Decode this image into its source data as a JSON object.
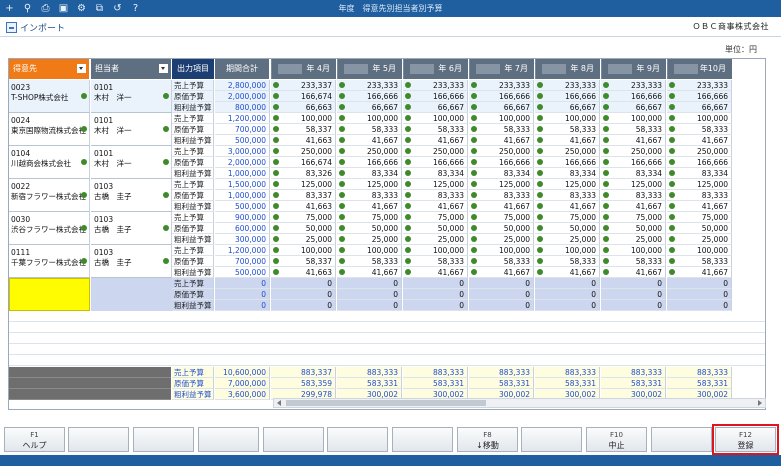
{
  "window": {
    "title": "年度　得意先別担当者別予算",
    "toolbar_icons": [
      "add-icon",
      "zoom-icon",
      "print-icon",
      "view-icon",
      "settings-icon",
      "copy-icon",
      "history-icon",
      "help-icon"
    ]
  },
  "toolbar": {
    "import_label": "インポート",
    "company": "ＯＢＣ商事株式会社"
  },
  "unit_label": "単位：円",
  "grid": {
    "headers": {
      "customer": "得意先",
      "person": "担当者",
      "item": "出力項目",
      "total": "期間合計",
      "months": [
        "年 4月",
        "年 5月",
        "年 6月",
        "年 7月",
        "年 8月",
        "年 9月",
        "年10月"
      ]
    },
    "item_labels": [
      "売上予算",
      "原価予算",
      "粗利益予算"
    ],
    "groups": [
      {
        "cust_code": "0023",
        "cust_name": "T-SHOP株式会社",
        "person_code": "0101",
        "person_name": "木村　洋一",
        "rows": [
          {
            "total": "2,800,000",
            "months": [
              "233,337",
              "233,333",
              "233,333",
              "233,333",
              "233,333",
              "233,333",
              "233,333"
            ]
          },
          {
            "total": "2,000,000",
            "months": [
              "166,674",
              "166,666",
              "166,666",
              "166,666",
              "166,666",
              "166,666",
              "166,666"
            ]
          },
          {
            "total": "800,000",
            "months": [
              "66,663",
              "66,667",
              "66,667",
              "66,667",
              "66,667",
              "66,667",
              "66,667"
            ]
          }
        ]
      },
      {
        "cust_code": "0024",
        "cust_name": "東京国際物流株式会社",
        "person_code": "0101",
        "person_name": "木村　洋一",
        "rows": [
          {
            "total": "1,200,000",
            "months": [
              "100,000",
              "100,000",
              "100,000",
              "100,000",
              "100,000",
              "100,000",
              "100,000"
            ]
          },
          {
            "total": "700,000",
            "months": [
              "58,337",
              "58,333",
              "58,333",
              "58,333",
              "58,333",
              "58,333",
              "58,333"
            ]
          },
          {
            "total": "500,000",
            "months": [
              "41,663",
              "41,667",
              "41,667",
              "41,667",
              "41,667",
              "41,667",
              "41,667"
            ]
          }
        ]
      },
      {
        "cust_code": "0104",
        "cust_name": "川越商会株式会社",
        "person_code": "0101",
        "person_name": "木村　洋一",
        "rows": [
          {
            "total": "3,000,000",
            "months": [
              "250,000",
              "250,000",
              "250,000",
              "250,000",
              "250,000",
              "250,000",
              "250,000"
            ]
          },
          {
            "total": "2,000,000",
            "months": [
              "166,674",
              "166,666",
              "166,666",
              "166,666",
              "166,666",
              "166,666",
              "166,666"
            ]
          },
          {
            "total": "1,000,000",
            "months": [
              "83,326",
              "83,334",
              "83,334",
              "83,334",
              "83,334",
              "83,334",
              "83,334"
            ]
          }
        ]
      },
      {
        "cust_code": "0022",
        "cust_name": "新宿フラワー株式会社",
        "person_code": "0103",
        "person_name": "古橋　圭子",
        "rows": [
          {
            "total": "1,500,000",
            "months": [
              "125,000",
              "125,000",
              "125,000",
              "125,000",
              "125,000",
              "125,000",
              "125,000"
            ]
          },
          {
            "total": "1,000,000",
            "months": [
              "83,337",
              "83,333",
              "83,333",
              "83,333",
              "83,333",
              "83,333",
              "83,333"
            ]
          },
          {
            "total": "500,000",
            "months": [
              "41,663",
              "41,667",
              "41,667",
              "41,667",
              "41,667",
              "41,667",
              "41,667"
            ]
          }
        ]
      },
      {
        "cust_code": "0030",
        "cust_name": "渋谷フラワー株式会社",
        "person_code": "0103",
        "person_name": "古橋　圭子",
        "rows": [
          {
            "total": "900,000",
            "months": [
              "75,000",
              "75,000",
              "75,000",
              "75,000",
              "75,000",
              "75,000",
              "75,000"
            ]
          },
          {
            "total": "600,000",
            "months": [
              "50,000",
              "50,000",
              "50,000",
              "50,000",
              "50,000",
              "50,000",
              "50,000"
            ]
          },
          {
            "total": "300,000",
            "months": [
              "25,000",
              "25,000",
              "25,000",
              "25,000",
              "25,000",
              "25,000",
              "25,000"
            ]
          }
        ]
      },
      {
        "cust_code": "0111",
        "cust_name": "千葉フラワー株式会社",
        "person_code": "0103",
        "person_name": "古橋　圭子",
        "rows": [
          {
            "total": "1,200,000",
            "months": [
              "100,000",
              "100,000",
              "100,000",
              "100,000",
              "100,000",
              "100,000",
              "100,000"
            ]
          },
          {
            "total": "700,000",
            "months": [
              "58,337",
              "58,333",
              "58,333",
              "58,333",
              "58,333",
              "58,333",
              "58,333"
            ]
          },
          {
            "total": "500,000",
            "months": [
              "41,663",
              "41,667",
              "41,667",
              "41,667",
              "41,667",
              "41,667",
              "41,667"
            ]
          }
        ]
      }
    ],
    "empty_rows": [
      {
        "total": "0",
        "months": [
          "0",
          "0",
          "0",
          "0",
          "0",
          "0",
          "0"
        ]
      },
      {
        "total": "0",
        "months": [
          "0",
          "0",
          "0",
          "0",
          "0",
          "0",
          "0"
        ]
      },
      {
        "total": "0",
        "months": [
          "0",
          "0",
          "0",
          "0",
          "0",
          "0",
          "0"
        ]
      }
    ],
    "summary": [
      {
        "total": "10,600,000",
        "months": [
          "883,337",
          "883,333",
          "883,333",
          "883,333",
          "883,333",
          "883,333",
          "883,333"
        ]
      },
      {
        "total": "7,000,000",
        "months": [
          "583,359",
          "583,331",
          "583,331",
          "583,331",
          "583,331",
          "583,331",
          "583,331"
        ]
      },
      {
        "total": "3,600,000",
        "months": [
          "299,978",
          "300,002",
          "300,002",
          "300,002",
          "300,002",
          "300,002",
          "300,002"
        ]
      }
    ]
  },
  "function_keys": [
    {
      "key": "F1",
      "label": "ヘルプ"
    },
    {
      "key": "",
      "label": ""
    },
    {
      "key": "",
      "label": ""
    },
    {
      "key": "",
      "label": ""
    },
    {
      "key": "",
      "label": ""
    },
    {
      "key": "",
      "label": ""
    },
    {
      "key": "",
      "label": ""
    },
    {
      "key": "F8",
      "label": "↓移動"
    },
    {
      "key": "",
      "label": ""
    },
    {
      "key": "F10",
      "label": "中止"
    },
    {
      "key": "",
      "label": ""
    },
    {
      "key": "F12",
      "label": "登録"
    }
  ]
}
